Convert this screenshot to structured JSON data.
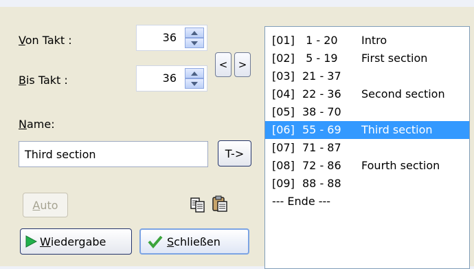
{
  "from_bar": {
    "label_mnemonic": "V",
    "label_rest": "on Takt :",
    "value": "36"
  },
  "to_bar": {
    "label_mnemonic": "B",
    "label_rest": "is Takt :",
    "value": "36"
  },
  "nav": {
    "left": "<",
    "right": ">"
  },
  "name": {
    "label_mnemonic": "N",
    "label_rest": "ame:",
    "value": "Third section"
  },
  "buttons": {
    "t_arrow": "T->",
    "auto_mnemonic": "A",
    "auto_rest": "uto",
    "play_mnemonic": "W",
    "play_rest": "iedergabe",
    "close_mnemonic": "S",
    "close_rest": "chließen"
  },
  "sections": [
    {
      "idx": "[01]",
      "range": " 1 - 20",
      "title": "Intro",
      "selected": false
    },
    {
      "idx": "[02]",
      "range": " 5 - 19",
      "title": "First section",
      "selected": false
    },
    {
      "idx": "[03]",
      "range": "21 - 37",
      "title": "",
      "selected": false
    },
    {
      "idx": "[04]",
      "range": "22 - 36",
      "title": "Second section",
      "selected": false
    },
    {
      "idx": "[05]",
      "range": "38 - 70",
      "title": "",
      "selected": false
    },
    {
      "idx": "[06]",
      "range": "55 - 69",
      "title": "Third section",
      "selected": true
    },
    {
      "idx": "[07]",
      "range": "71 - 87",
      "title": "",
      "selected": false
    },
    {
      "idx": "[08]",
      "range": "72 - 86",
      "title": "Fourth section",
      "selected": false
    },
    {
      "idx": "[09]",
      "range": "88 - 88",
      "title": "",
      "selected": false
    }
  ],
  "end_marker": "--- Ende ---",
  "colors": {
    "selection": "#3399ff",
    "panel": "#ece9d8",
    "play_icon": "#22b14c",
    "check_icon": "#3ca43c"
  }
}
